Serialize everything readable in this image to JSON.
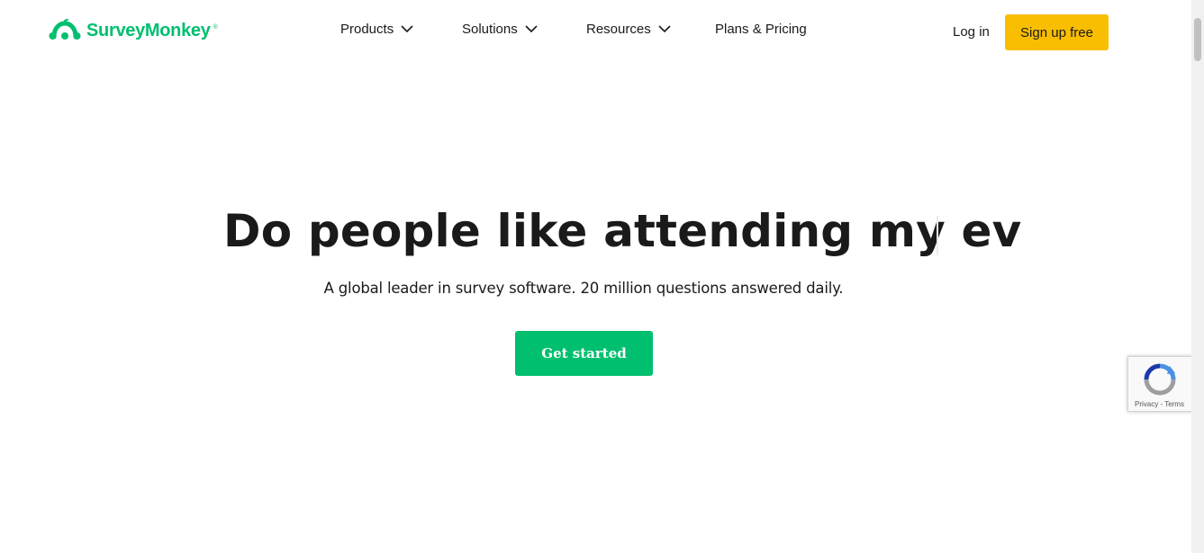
{
  "header": {
    "brand": "SurveyMonkey",
    "brand_mark": "®",
    "nav": [
      {
        "label": "Products",
        "has_dropdown": true
      },
      {
        "label": "Solutions",
        "has_dropdown": true
      },
      {
        "label": "Resources",
        "has_dropdown": true
      },
      {
        "label": "Plans & Pricing",
        "has_dropdown": false
      }
    ],
    "login_label": "Log in",
    "signup_label": "Sign up free"
  },
  "hero": {
    "title": "Do people like attending my ev",
    "subtitle": "A global leader in survey software. 20 million questions answered daily.",
    "cta_label": "Get started"
  },
  "recaptcha": {
    "links": "Privacy - Terms"
  },
  "colors": {
    "brand_green": "#00bf6f",
    "signup_yellow": "#f9be00",
    "text": "#1a1a1a"
  },
  "icons": [
    "surveymonkey-logo-icon",
    "chevron-down-icon",
    "recaptcha-icon"
  ]
}
